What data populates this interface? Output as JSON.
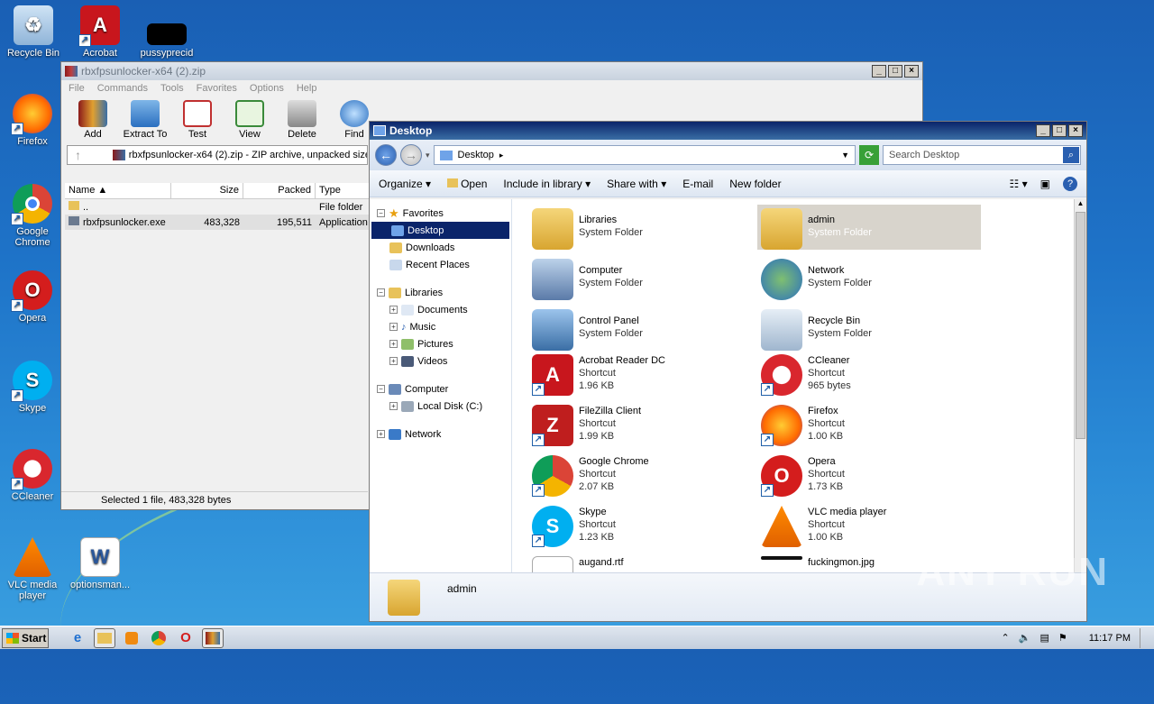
{
  "desktop": {
    "icons": [
      {
        "label": "Recycle Bin",
        "icon": "recycle-bin-icon"
      },
      {
        "label": "Acrobat",
        "icon": "acrobat-icon"
      },
      {
        "label": "pussyprecid",
        "icon": "blank-file-icon"
      },
      {
        "label": "Firefox",
        "icon": "firefox-icon"
      },
      {
        "label": "Google Chrome",
        "icon": "chrome-icon"
      },
      {
        "label": "Opera",
        "icon": "opera-icon"
      },
      {
        "label": "Skype",
        "icon": "skype-icon"
      },
      {
        "label": "CCleaner",
        "icon": "ccleaner-icon"
      },
      {
        "label": "VLC media player",
        "icon": "vlc-icon"
      },
      {
        "label": "optionsman...",
        "icon": "word-doc-icon"
      }
    ],
    "watermark": "ANY RUN"
  },
  "winrar": {
    "title": "rbxfpsunlocker-x64 (2).zip",
    "menu": [
      "File",
      "Commands",
      "Tools",
      "Favorites",
      "Options",
      "Help"
    ],
    "toolbar": [
      "Add",
      "Extract To",
      "Test",
      "View",
      "Delete",
      "Find"
    ],
    "path": "rbxfpsunlocker-x64 (2).zip - ZIP archive, unpacked size",
    "columns": {
      "name": "Name",
      "size": "Size",
      "packed": "Packed",
      "type": "Type"
    },
    "rows": [
      {
        "name": "..",
        "size": "",
        "packed": "",
        "type": "File folder"
      },
      {
        "name": "rbxfpsunlocker.exe",
        "size": "483,328",
        "packed": "195,511",
        "type": "Application"
      }
    ],
    "status": "Selected 1 file, 483,328 bytes"
  },
  "explorer": {
    "title": "Desktop",
    "address": "Desktop",
    "search_placeholder": "Search Desktop",
    "commands": [
      "Organize",
      "Open",
      "Include in library",
      "Share with",
      "E-mail",
      "New folder"
    ],
    "nav": {
      "favorites": "Favorites",
      "desktop": "Desktop",
      "downloads": "Downloads",
      "recent": "Recent Places",
      "libraries": "Libraries",
      "documents": "Documents",
      "music": "Music",
      "pictures": "Pictures",
      "videos": "Videos",
      "computer": "Computer",
      "localdisk": "Local Disk (C:)",
      "network": "Network"
    },
    "items": [
      {
        "name": "Libraries",
        "line2": "System Folder",
        "line3": ""
      },
      {
        "name": "admin",
        "line2": "System Folder",
        "line3": ""
      },
      {
        "name": "Computer",
        "line2": "System Folder",
        "line3": ""
      },
      {
        "name": "Network",
        "line2": "System Folder",
        "line3": ""
      },
      {
        "name": "Control Panel",
        "line2": "System Folder",
        "line3": ""
      },
      {
        "name": "Recycle Bin",
        "line2": "System Folder",
        "line3": ""
      },
      {
        "name": "Acrobat Reader DC",
        "line2": "Shortcut",
        "line3": "1.96 KB"
      },
      {
        "name": "CCleaner",
        "line2": "Shortcut",
        "line3": "965 bytes"
      },
      {
        "name": "FileZilla Client",
        "line2": "Shortcut",
        "line3": "1.99 KB"
      },
      {
        "name": "Firefox",
        "line2": "Shortcut",
        "line3": "1.00 KB"
      },
      {
        "name": "Google Chrome",
        "line2": "Shortcut",
        "line3": "2.07 KB"
      },
      {
        "name": "Opera",
        "line2": "Shortcut",
        "line3": "1.73 KB"
      },
      {
        "name": "Skype",
        "line2": "Shortcut",
        "line3": "1.23 KB"
      },
      {
        "name": "VLC media player",
        "line2": "Shortcut",
        "line3": "1.00 KB"
      },
      {
        "name": "augand.rtf",
        "line2": "",
        "line3": ""
      },
      {
        "name": "fuckingmon.jpg",
        "line2": "",
        "line3": ""
      }
    ],
    "details_name": "admin"
  },
  "taskbar": {
    "start": "Start",
    "clock": "11:17 PM"
  }
}
